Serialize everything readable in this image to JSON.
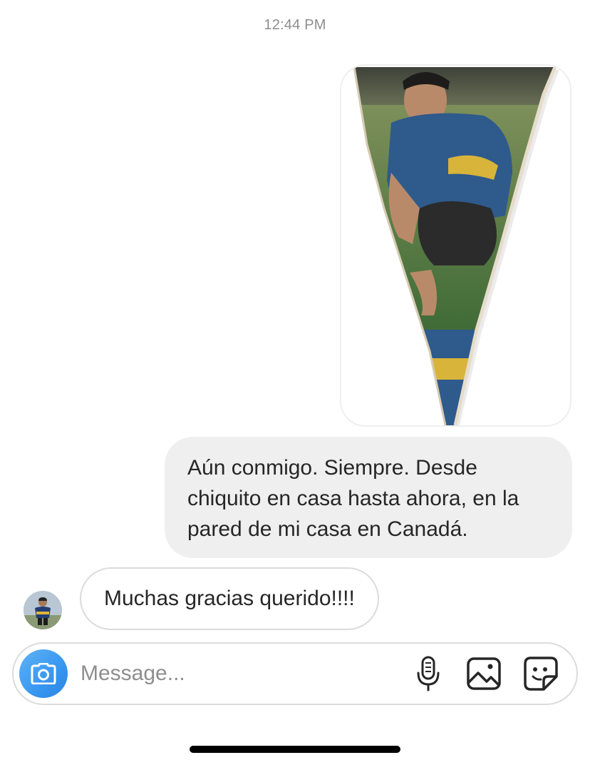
{
  "thread": {
    "timestamp": "12:44 PM",
    "messages": [
      {
        "type": "image",
        "direction": "sent",
        "image_description_icon": "pennant-photo"
      },
      {
        "type": "text",
        "direction": "sent",
        "text": "Aún conmigo. Siempre. Desde chiquito en casa hasta ahora, en la pared de mi casa en Canadá."
      },
      {
        "type": "text",
        "direction": "received",
        "text": "Muchas gracias querido!!!!"
      }
    ]
  },
  "composer": {
    "placeholder": "Message...",
    "value": "",
    "icons": [
      "camera-icon",
      "microphone-icon",
      "gallery-icon",
      "sticker-icon"
    ]
  },
  "colors": {
    "camera_accent": "#3897f0",
    "sent_bubble": "#efefef",
    "border": "#dbdbdb",
    "muted_text": "#8e8e8e"
  }
}
